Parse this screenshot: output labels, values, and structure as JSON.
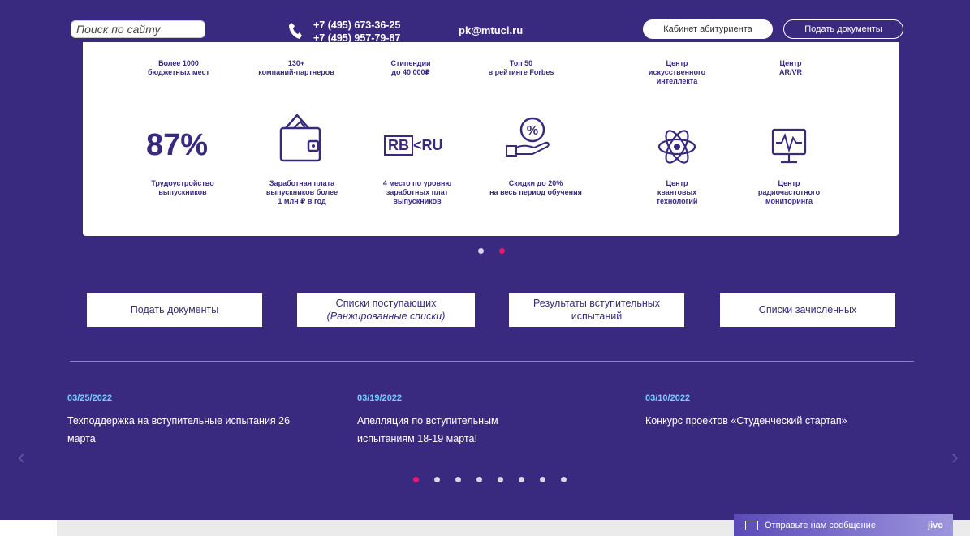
{
  "header": {
    "search_placeholder": "Поиск по сайту",
    "phone1": "+7 (495) 673-36-25",
    "phone2": "+7 (495) 957-79-87",
    "email": "pk@mtuci.ru",
    "cabinet_label": "Кабинет абитуриента",
    "submit_docs_label": "Подать документы"
  },
  "features_top": [
    {
      "line1": "Более 1000",
      "line2": "бюджетных мест",
      "line3": ""
    },
    {
      "line1": "130+",
      "line2": "компаний-партнеров",
      "line3": ""
    },
    {
      "line1": "Стипендии",
      "line2": "до 40 000₽",
      "line3": ""
    },
    {
      "line1": "Топ 50",
      "line2": "в рейтинге Forbes",
      "line3": ""
    },
    {
      "line1": "Центр",
      "line2": "искусственного",
      "line3": "интеллекта"
    },
    {
      "line1": "Центр",
      "line2": "AR/VR",
      "line3": ""
    }
  ],
  "features_bottom": [
    {
      "big": "87%",
      "line1": "Трудоустройство",
      "line2": "выпускников",
      "line3": ""
    },
    {
      "line1": "Заработная плата",
      "line2": "выпускников более",
      "line3": "1 млн ₽ в год"
    },
    {
      "logo": "RB",
      "logo2": "RU",
      "line1": "4 место по уровню",
      "line2": "заработных плат",
      "line3": "выпускников"
    },
    {
      "line1": "Скидки до 20%",
      "line2": "на весь период обучения",
      "line3": ""
    },
    {
      "line1": "Центр",
      "line2": "квантовых",
      "line3": "технологий"
    },
    {
      "line1": "Центр",
      "line2": "радиочастотного",
      "line3": "мониторинга"
    }
  ],
  "slider": {
    "dots": 2,
    "active": 1
  },
  "buttons": [
    {
      "line1": "Подать документы",
      "line2": ""
    },
    {
      "line1": "Списки поступающих",
      "line2": "(Ранжированные списки)"
    },
    {
      "line1": "Результаты вступительных",
      "line2": "испытаний"
    },
    {
      "line1": "Списки зачисленных",
      "line2": ""
    }
  ],
  "news": [
    {
      "date": "03/25/2022",
      "title": "Техподдержка на вступительные испытания 26 марта"
    },
    {
      "date": "03/19/2022",
      "title": "Апелляция по вступительным испытаниям 18-19 марта!"
    },
    {
      "date": "03/10/2022",
      "title": "Конкурс проектов «Студенческий стартап»"
    }
  ],
  "news_pager": {
    "dots": 8,
    "active": 0
  },
  "chat": {
    "label": "Отправьте нам сообщение",
    "brand": "jivo"
  },
  "colors": {
    "bg": "#3a2a7f",
    "accent": "#e8196b",
    "date": "#6fd0ff"
  }
}
